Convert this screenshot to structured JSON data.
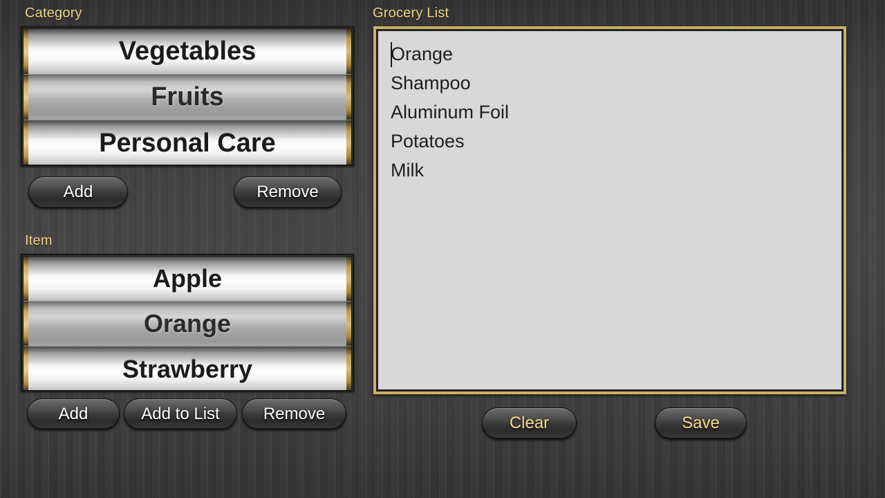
{
  "theme": {
    "background_color": "#3a3a3a",
    "label_color": "#f2d487",
    "gold_border_color": "#cdae6a",
    "textarea_background": "#d8d8d8",
    "button_text_color": "#ffffff",
    "gold_button_text_color": "#f5d98c"
  },
  "category_section": {
    "label": "Category",
    "rows": [
      {
        "label": "Vegetables",
        "state": "bright"
      },
      {
        "label": "Fruits",
        "state": "dim"
      },
      {
        "label": "Personal Care",
        "state": "bright"
      }
    ],
    "buttons": [
      {
        "label": "Add",
        "name": "category-add-button"
      },
      {
        "label": "Remove",
        "name": "category-remove-button"
      }
    ]
  },
  "item_section": {
    "label": "Item",
    "rows": [
      {
        "label": "Apple",
        "state": "bright"
      },
      {
        "label": "Orange",
        "state": "dim"
      },
      {
        "label": "Strawberry",
        "state": "bright"
      }
    ],
    "buttons": [
      {
        "label": "Add",
        "name": "item-add-button"
      },
      {
        "label": "Add to List",
        "name": "item-add-to-list-button"
      },
      {
        "label": "Remove",
        "name": "item-remove-button"
      }
    ]
  },
  "grocery_section": {
    "label": "Grocery List",
    "lines": [
      "Orange",
      "Shampoo",
      "Aluminum Foil",
      "Potatoes",
      "Milk"
    ],
    "caret_visible": true,
    "buttons": [
      {
        "label": "Clear",
        "name": "clear-button"
      },
      {
        "label": "Save",
        "name": "save-button"
      }
    ]
  }
}
